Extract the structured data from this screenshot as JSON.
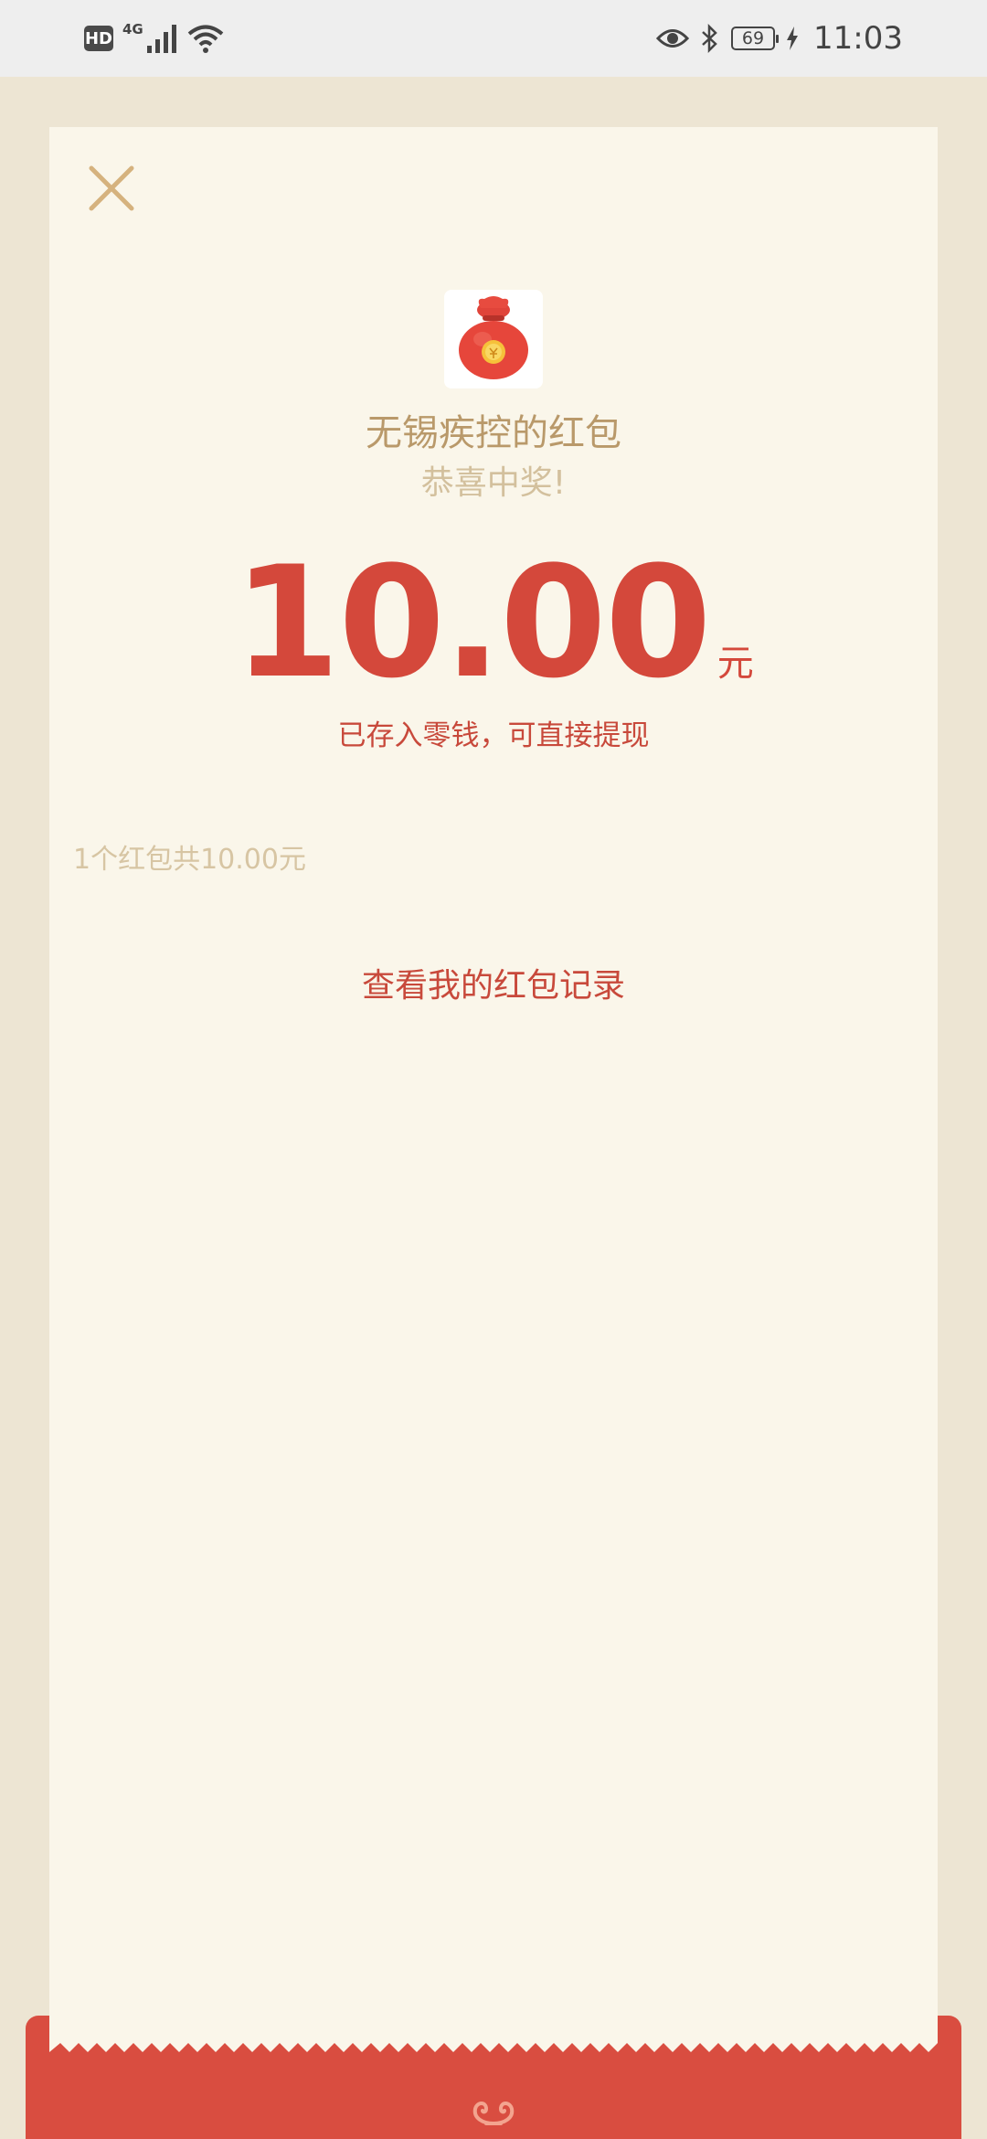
{
  "status_bar": {
    "hd": "HD",
    "network": "4G",
    "battery": "69",
    "time": "11:03"
  },
  "red_packet": {
    "sender_title": "无锡疾控的红包",
    "congrats": "恭喜中奖!",
    "amount": "10.00",
    "unit": "元",
    "deposit_note": "已存入零钱，可直接提现",
    "summary": "1个红包共10.00元",
    "record_link": "查看我的红包记录"
  },
  "colors": {
    "background": "#ede5d3",
    "card": "#faf6ea",
    "accent_red": "#d94d40",
    "gold": "#b9996a"
  },
  "icons": [
    "close-icon",
    "money-bag-icon",
    "hd-icon",
    "signal-icon",
    "wifi-icon",
    "eye-icon",
    "bluetooth-icon",
    "charging-icon",
    "cloud-ornament-icon"
  ]
}
